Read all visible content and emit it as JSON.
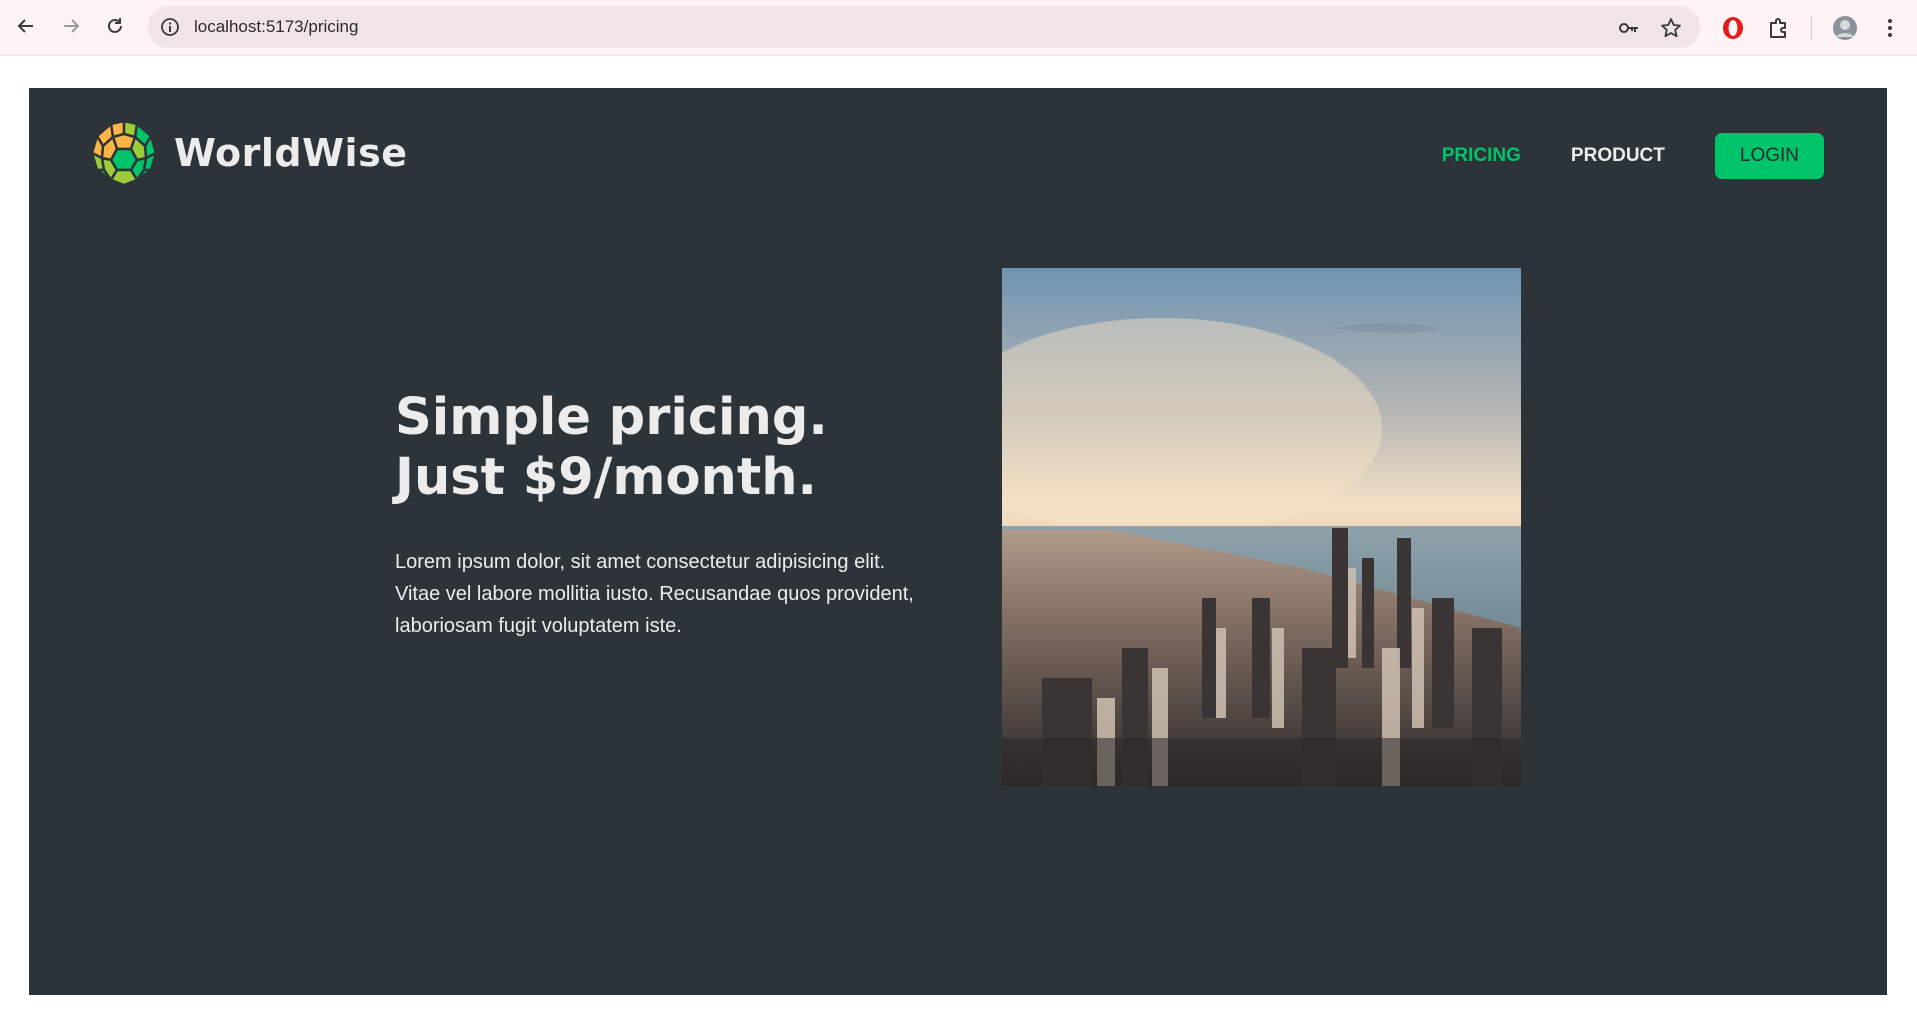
{
  "browser": {
    "url": "localhost:5173/pricing"
  },
  "site": {
    "logo_text": "WorldWise",
    "nav": {
      "pricing": "PRICING",
      "product": "PRODUCT",
      "login": "LOGIN"
    }
  },
  "hero": {
    "title_line1": "Simple pricing.",
    "title_line2": "Just $9/month.",
    "paragraph": "Lorem ipsum dolor, sit amet consectetur adipisicing elit. Vitae vel labore mollitia iusto. Recusandae quos provident, laboriosam fugit voluptatem iste.",
    "image_icon": "city-skyline-photo"
  },
  "colors": {
    "page_bg": "#2d3439",
    "accent": "#00c46a",
    "text": "#ececec"
  },
  "icons": {
    "back": "back-arrow-icon",
    "forward": "forward-arrow-icon",
    "reload": "reload-icon",
    "site_info": "info-icon",
    "password": "key-icon",
    "bookmark": "star-icon",
    "extension_opera": "opera-icon",
    "extensions": "puzzle-icon",
    "profile": "avatar",
    "menu": "more-vert-icon"
  }
}
